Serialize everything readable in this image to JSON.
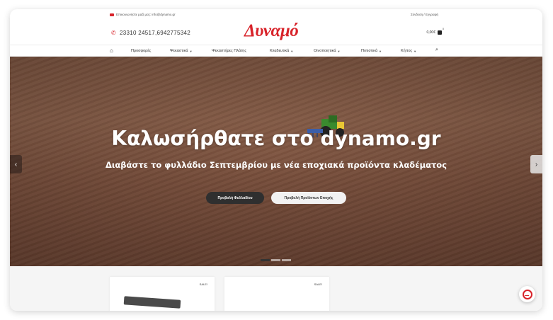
{
  "topbar": {
    "email_label": "Επικοινωνήστε μαζί μας: info@dynamo.gr",
    "login_label": "Σύνδεση / Εγγραφή"
  },
  "header": {
    "phone": "23310 24517,6942775342",
    "logo_text": "Δυναμό",
    "cart_total": "0,00€",
    "cart_count": "0"
  },
  "nav": {
    "items": [
      {
        "label": "Προσφορές",
        "has_dropdown": false
      },
      {
        "label": "Ψεκαστικά",
        "has_dropdown": true
      },
      {
        "label": "Ψεκαστήρες Πλάτης",
        "has_dropdown": false
      },
      {
        "label": "Κλαδευτικά",
        "has_dropdown": true
      },
      {
        "label": "Οινοποιητικά",
        "has_dropdown": true
      },
      {
        "label": "Ποτιστικά",
        "has_dropdown": true
      },
      {
        "label": "Κήπος",
        "has_dropdown": true
      }
    ]
  },
  "hero": {
    "title": "Καλωσήρθατε στο dynamo.gr",
    "subtitle": "Διαβάστε το φυλλάδιο Σεπτεμβρίου με νέα εποχιακά προϊόντα κλαδέματος",
    "primary_button": "Προβολή Φυλλαδίου",
    "secondary_button": "Προβολή Προϊόντων Εποχής",
    "slides": 3,
    "active_slide": 1
  },
  "products": [
    {
      "badge": "SALE!"
    },
    {
      "badge": "SALE!"
    }
  ],
  "colors": {
    "brand": "#d8232a",
    "dark_button": "#2f2f2f"
  }
}
